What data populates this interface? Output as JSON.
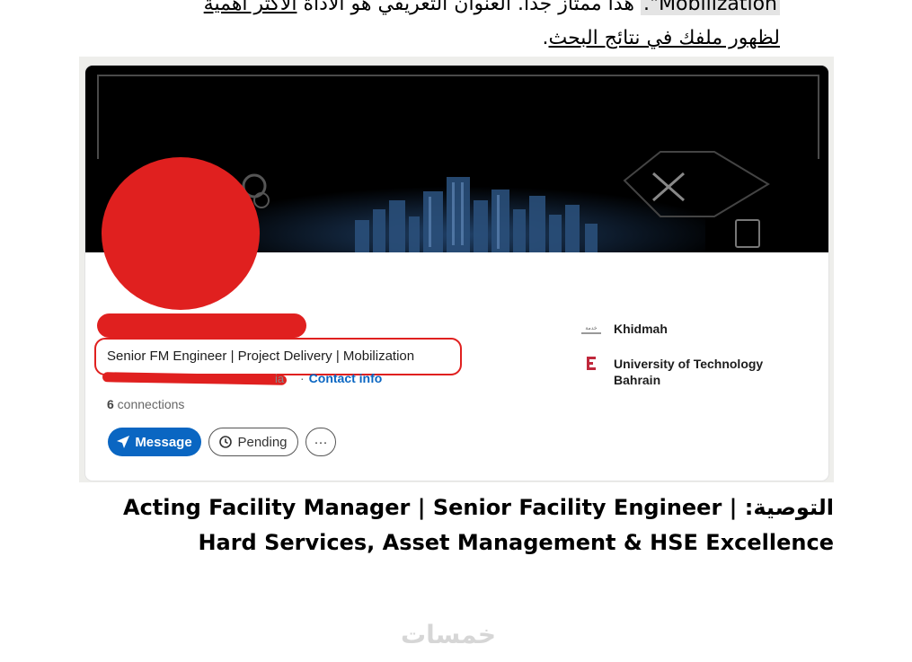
{
  "intro_text": {
    "line1_highlight": "Mobilization\".",
    "line1_plain": " هذا ممتاز جداً. العنوان التعريفي هو الأداة ",
    "line1_underlined": "الأكثر أهمية",
    "line2_underlined": "لظهور ملفك في نتائج البحث",
    "line2_end": "."
  },
  "profile": {
    "headline": "Senior FM Engineer | Project Delivery | Mobilization",
    "location_fragment": "ia",
    "contact_info": "Contact info",
    "separator": "·",
    "connections_count": "6",
    "connections_label": " connections",
    "buttons": {
      "message": "Message",
      "pending": "Pending",
      "more": "···"
    },
    "companies": [
      {
        "name": "Khidmah",
        "icon": "khidmah-logo"
      },
      {
        "name": "University of Technology Bahrain",
        "icon": "utb-logo"
      }
    ]
  },
  "recommendation": {
    "label": "التوصية: ",
    "text": "Acting Facility Manager | Senior Facility Engineer | Hard Services, Asset Management & HSE Excellence"
  },
  "watermark": "خمسات",
  "colors": {
    "redaction": "#e0201f",
    "linkedin_blue": "#0a66c2",
    "banner": "#000000"
  }
}
